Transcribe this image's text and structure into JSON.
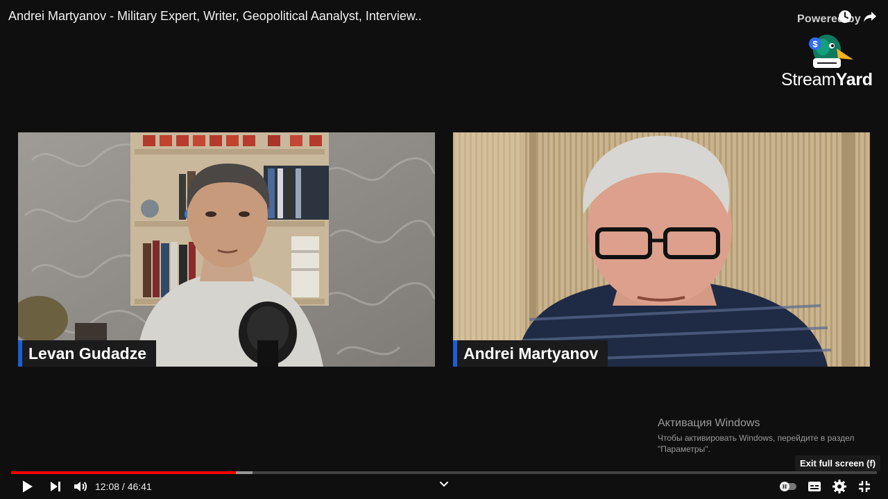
{
  "video": {
    "title": "Andrei Martyanov - Military Expert, Writer, Geopolitical Aanalyst, Interview..",
    "progress": 0.2593,
    "buffered": 0.2785
  },
  "overlay": {
    "powered_by": "Powered by",
    "logo": {
      "name_part1": "Stream",
      "name_part2": "Yard"
    }
  },
  "participants": [
    {
      "name": "Levan Gudadze"
    },
    {
      "name": "Andrei Martyanov"
    }
  ],
  "windows_activation": {
    "title": "Активация Windows",
    "line1": "Чтобы активировать Windows, перейдите в раздел",
    "line2": "\"Параметры\"."
  },
  "tooltip": {
    "exit_fullscreen": "Exit full screen (f)"
  },
  "player": {
    "current_time": "12:08",
    "duration": "46:41",
    "time_separator": " / "
  },
  "icons": {
    "watch_later": "clock-icon",
    "share": "share-icon",
    "play": "play-icon",
    "next": "next-icon",
    "volume": "volume-icon",
    "chevron": "chevron-down-icon",
    "autoplay": "autoplay-toggle-icon",
    "captions": "captions-icon",
    "settings": "gear-icon",
    "exit_fullscreen": "exit-fullscreen-icon"
  },
  "colors": {
    "accent_red": "#ff0000",
    "nameplate_accent": "#1a5fd6"
  }
}
